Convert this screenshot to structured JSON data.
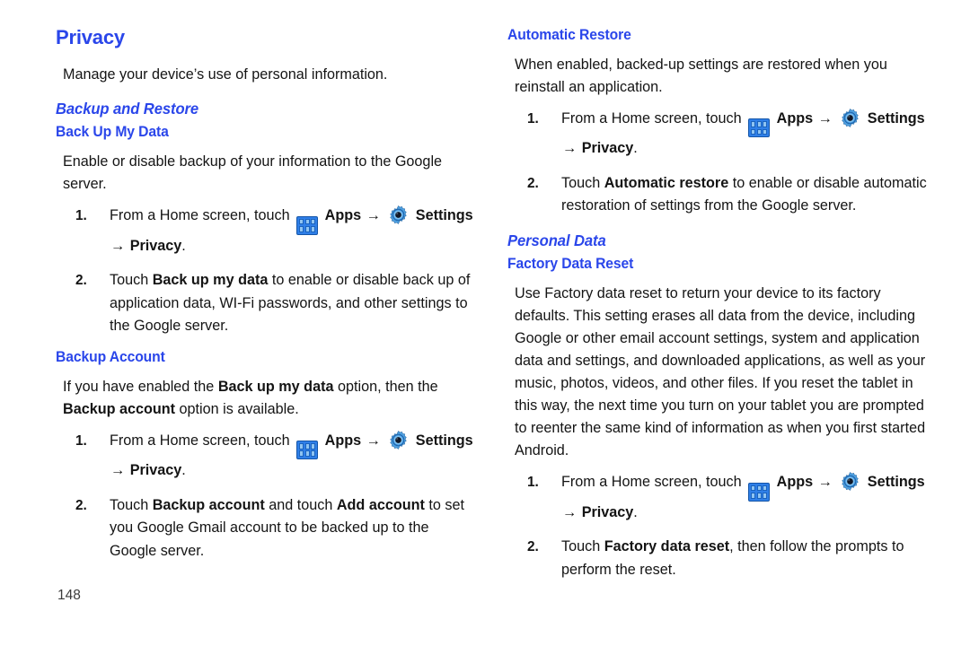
{
  "page": {
    "number": "148",
    "accent_color": "#2a46ea",
    "text_color": "#141414"
  },
  "icons": {
    "apps": "apps-grid-icon",
    "settings": "gear-icon",
    "arrow": "→"
  },
  "left_column": {
    "title": "Privacy",
    "intro": "Manage your device’s use of personal information.",
    "section_heading": "Backup and Restore",
    "subsections": [
      {
        "heading": "Back Up My Data",
        "body": "Enable or disable backup of your information to the Google server.",
        "steps": [
          {
            "number": "1.",
            "prefix": "From a Home screen, touch ",
            "apps_label": "Apps",
            "settings_label": "Settings",
            "suffix_arrow": "→",
            "suffix_bold": "Privacy",
            "suffix_end": "."
          },
          {
            "number": "2.",
            "segments": [
              {
                "text": "Touch ",
                "bold": false
              },
              {
                "text": "Back up my data",
                "bold": true
              },
              {
                "text": " to enable or disable back up of application data, WI-Fi passwords, and other settings to the Google server.",
                "bold": false
              }
            ]
          }
        ]
      },
      {
        "heading": "Backup Account",
        "body_segments": [
          {
            "text": "If you have enabled the ",
            "bold": false
          },
          {
            "text": "Back up my data",
            "bold": true
          },
          {
            "text": " option, then the ",
            "bold": false
          },
          {
            "text": "Backup account",
            "bold": true
          },
          {
            "text": " option is available.",
            "bold": false
          }
        ],
        "steps": [
          {
            "number": "1.",
            "prefix": "From a Home screen, touch ",
            "apps_label": "Apps",
            "settings_label": "Settings",
            "suffix_arrow": "→",
            "suffix_bold": "Privacy",
            "suffix_end": "."
          },
          {
            "number": "2.",
            "segments": [
              {
                "text": "Touch ",
                "bold": false
              },
              {
                "text": "Backup account",
                "bold": true
              },
              {
                "text": " and touch ",
                "bold": false
              },
              {
                "text": "Add account",
                "bold": true
              },
              {
                "text": " to set you Google Gmail account to be backed up to the Google server.",
                "bold": false
              }
            ]
          }
        ]
      }
    ]
  },
  "right_column": {
    "subsections": [
      {
        "heading": "Automatic Restore",
        "body": "When enabled, backed-up settings are restored when you reinstall an application.",
        "steps": [
          {
            "number": "1.",
            "prefix": "From a Home screen, touch ",
            "apps_label": "Apps",
            "settings_label": "Settings",
            "suffix_arrow": "→",
            "suffix_bold": "Privacy",
            "suffix_end": "."
          },
          {
            "number": "2.",
            "segments": [
              {
                "text": "Touch ",
                "bold": false
              },
              {
                "text": "Automatic restore",
                "bold": true
              },
              {
                "text": " to enable or disable automatic restoration of settings from the Google server.",
                "bold": false
              }
            ]
          }
        ]
      }
    ],
    "section_heading": "Personal Data",
    "factory": {
      "heading": "Factory Data Reset",
      "body": "Use Factory data reset to return your device to its factory defaults. This setting erases all data from the device, including Google or other email account settings, system and application data and settings, and downloaded applications, as well as your music, photos, videos, and other files. If you reset the tablet in this way, the next time you turn on your tablet you are prompted to reenter the same kind of information as when you first started Android.",
      "steps": [
        {
          "number": "1.",
          "prefix": "From a Home screen, touch ",
          "apps_label": "Apps",
          "settings_label": "Settings",
          "suffix_arrow": "→",
          "suffix_bold": "Privacy",
          "suffix_end": "."
        },
        {
          "number": "2.",
          "segments": [
            {
              "text": "Touch ",
              "bold": false
            },
            {
              "text": "Factory data reset",
              "bold": true
            },
            {
              "text": ", then follow the prompts to perform the reset.",
              "bold": false
            }
          ]
        }
      ]
    }
  }
}
